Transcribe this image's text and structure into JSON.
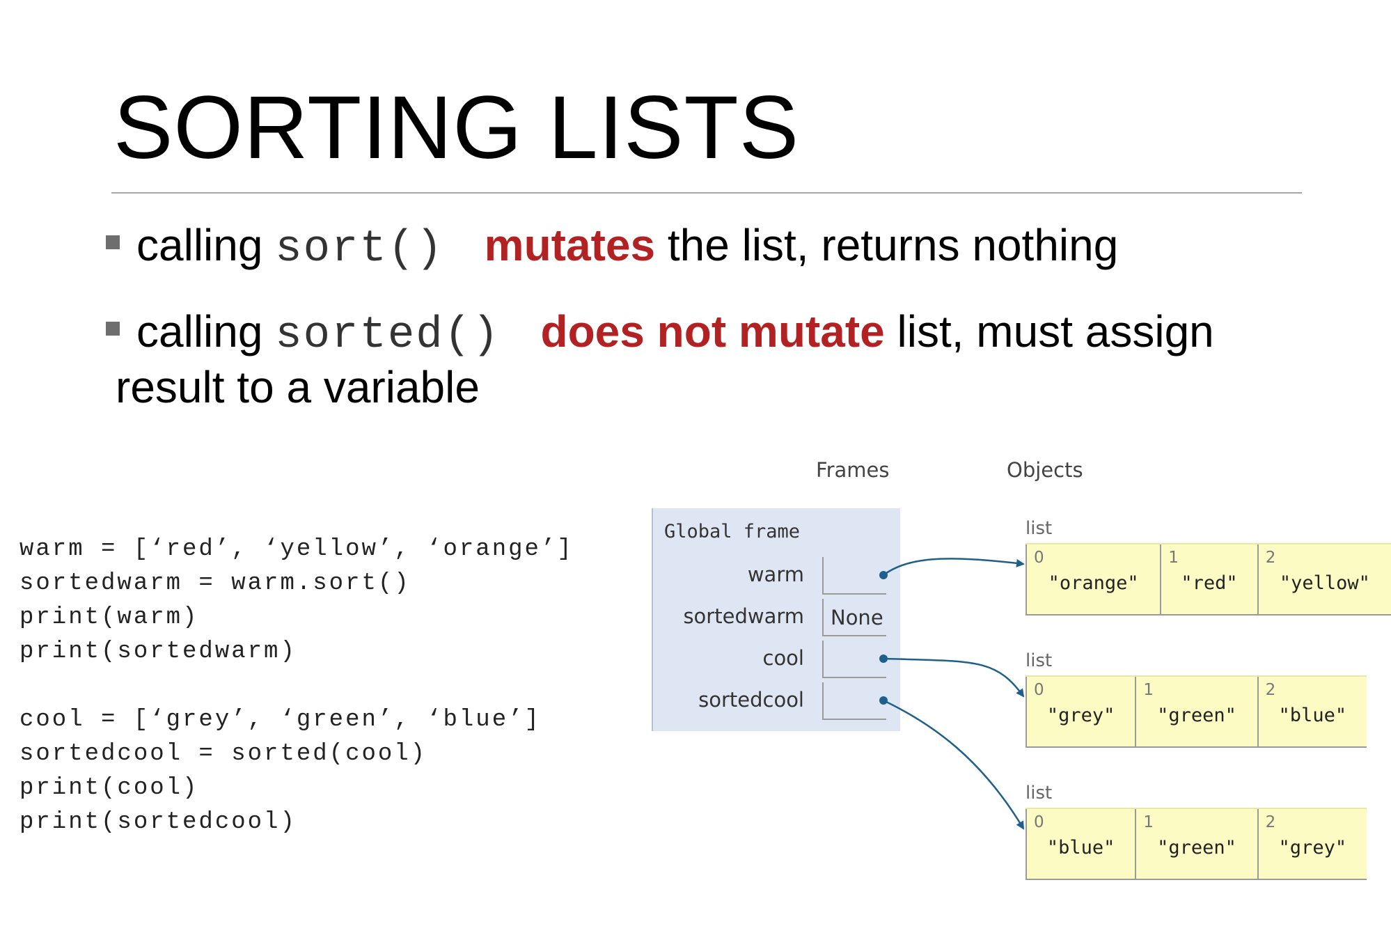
{
  "title": "SORTING LISTS",
  "bullets": [
    {
      "prefix": "calling ",
      "code": "sort()",
      "emph": "mutates",
      "rest": " the list, returns nothing"
    },
    {
      "prefix": "calling ",
      "code": "sorted()",
      "emph": "does not mutate",
      "rest": " list, must assign",
      "continuation": "result to a variable"
    }
  ],
  "code_block_1": "warm = [‘red’, ‘yellow’, ‘orange’]\nsortedwarm = warm.sort()\nprint(warm)\nprint(sortedwarm)",
  "code_block_2": "cool = [‘grey’, ‘green’, ‘blue’]\nsortedcool = sorted(cool)\nprint(cool)\nprint(sortedcool)",
  "diagram": {
    "frames_header": "Frames",
    "objects_header": "Objects",
    "frame_title": "Global frame",
    "variables": [
      {
        "name": "warm",
        "value": ""
      },
      {
        "name": "sortedwarm",
        "value": "None"
      },
      {
        "name": "cool",
        "value": ""
      },
      {
        "name": "sortedcool",
        "value": ""
      }
    ],
    "lists": [
      {
        "label": "list",
        "items": [
          {
            "index": "0",
            "value": "\"orange\""
          },
          {
            "index": "1",
            "value": "\"red\""
          },
          {
            "index": "2",
            "value": "\"yellow\""
          }
        ]
      },
      {
        "label": "list",
        "items": [
          {
            "index": "0",
            "value": "\"grey\""
          },
          {
            "index": "1",
            "value": "\"green\""
          },
          {
            "index": "2",
            "value": "\"blue\""
          }
        ]
      },
      {
        "label": "list",
        "items": [
          {
            "index": "0",
            "value": "\"blue\""
          },
          {
            "index": "1",
            "value": "\"green\""
          },
          {
            "index": "2",
            "value": "\"grey\""
          }
        ]
      }
    ]
  },
  "colors": {
    "emphasis": "#b22222",
    "frame_bg": "#dfe6f3",
    "list_bg": "#fcfbc3",
    "arrow": "#1f5f8b"
  }
}
